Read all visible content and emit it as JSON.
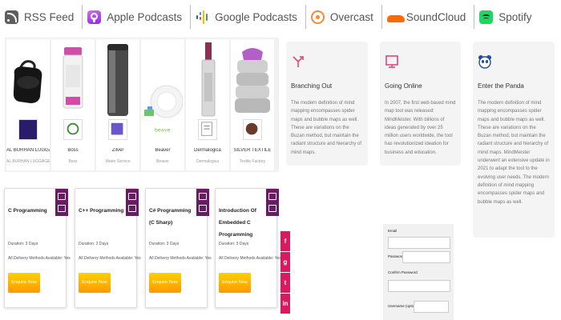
{
  "podcast_links": [
    {
      "label": "RSS Feed",
      "icon": "rss-icon",
      "color": "#5d5d5d"
    },
    {
      "label": "Apple Podcasts",
      "icon": "apple-podcasts-icon",
      "color": "#a44fe0"
    },
    {
      "label": "Google Podcasts",
      "icon": "google-podcasts-icon",
      "color": "#4285f4"
    },
    {
      "label": "Overcast",
      "icon": "overcast-icon",
      "color": "#f68a2e"
    },
    {
      "label": "SoundCloud",
      "icon": "soundcloud-icon",
      "color": "#ff6a00"
    },
    {
      "label": "Spotify",
      "icon": "spotify-icon",
      "color": "#1ed760"
    }
  ],
  "brands": [
    {
      "name": "AL BURHAN LUGGAGE",
      "category": "AL BURHAN LUGGAGE"
    },
    {
      "name": "Boss",
      "category": "Boss"
    },
    {
      "name": "Zilver",
      "category": "Water Service"
    },
    {
      "name": "Beaver",
      "category": "Beaver"
    },
    {
      "name": "Dermalogica",
      "category": "Dermalogica"
    },
    {
      "name": "SILVER TEXTILE",
      "category": "Textile Factory"
    }
  ],
  "info_cards": [
    {
      "icon": "branch-arrows-icon",
      "title": "Branching Out",
      "body": "The modern definition of mind mapping encompasses spider maps and bubble maps as well. These are variations on the Buzan method, but maintain the radiant structure and hierarchy of mind maps."
    },
    {
      "icon": "monitor-icon",
      "title": "Going Online",
      "body": "In 2007, the first web based mind map tool was released: MindMeister. With billions of ideas generated by over 25 million users worldwide, the tool has revolutionized ideation for business and education."
    },
    {
      "icon": "panda-icon",
      "title": "Enter the Panda",
      "body": "The modern definition of mind mapping encompasses spider maps and bubble maps as well. These are variations on the Buzan method, but maintain the radiant structure and hierarchy of mind maps. MindMeister underwent an extensive update in 2021 to adapt the tool to the evolving user needs. The modern definition of mind mapping encompasses spider maps and bubble maps as well."
    }
  ],
  "courses": [
    {
      "title": "C Programming",
      "duration": "Duration: 3 Days",
      "delivery": "All Delivery Methods Available: Yes",
      "button": "Enquire Now"
    },
    {
      "title": "C++ Programming",
      "duration": "Duration: 2 Days",
      "delivery": "All Delivery Methods Available: Yes",
      "button": "Enquire Now"
    },
    {
      "title": "C# Programming (C Sharp)",
      "duration": "Duration: 3 Days",
      "delivery": "All Delivery Methods Available: Yes",
      "button": "Enquire Now"
    },
    {
      "title": "Introduction Of Embedded C Programming",
      "duration": "Duration: 3 Days",
      "delivery": "All Delivery Methods Available: Yes",
      "button": "Enquire Now"
    }
  ],
  "social_buttons": [
    {
      "glyph": "f",
      "icon": "facebook-icon"
    },
    {
      "glyph": "g",
      "icon": "google-plus-icon"
    },
    {
      "glyph": "t",
      "icon": "twitter-icon"
    },
    {
      "glyph": "in",
      "icon": "linkedin-icon"
    }
  ],
  "form": {
    "email_label": "Email",
    "password_label": "Password",
    "confirm_label": "Confirm Password",
    "username_label": "Username (optional)"
  },
  "colors": {
    "ribbon": "#6b1a66",
    "enquire_button": "#ffb300",
    "social": "#d81b60",
    "info_icon": "#e0457b"
  }
}
